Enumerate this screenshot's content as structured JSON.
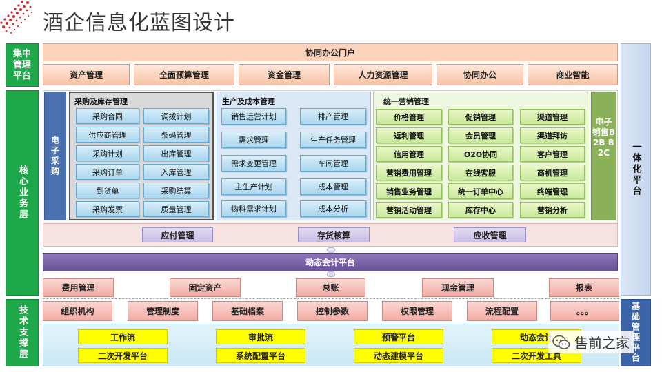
{
  "page_title": "酒企信息化蓝图设计",
  "left_labels": {
    "platform": "集中管理平台",
    "core": "核心业务层",
    "tech": "技术支撑层"
  },
  "right_labels": {
    "integrated": "一体化平台",
    "base": "基础管理平台"
  },
  "portal": "协同办公门户",
  "top_modules": [
    "资产管理",
    "全面预算管理",
    "资金管理",
    "人力资源管理",
    "协同办公",
    "商业智能"
  ],
  "e_purchase": "电子采购",
  "e_sales": "电子销售B2B B2C",
  "purchase_section": {
    "title": "采购及库存管理",
    "left": [
      "采购合同",
      "供应商管理",
      "采购计划",
      "采购订单",
      "到货单",
      "采购发票"
    ],
    "right": [
      "调拨计划",
      "条码管理",
      "出库管理",
      "入库管理",
      "采购结算",
      "质量管理"
    ]
  },
  "production_section": {
    "title": "生产及成本管理",
    "left": [
      "销售运营计划",
      "需求管理",
      "需求变更管理",
      "主生产计划",
      "物料需求计划"
    ],
    "right": [
      "排产管理",
      "生产任务管理",
      "车间管理",
      "成本管理",
      "成本分析"
    ]
  },
  "marketing_section": {
    "title": "统一营销管理",
    "col1": [
      "价格管理",
      "返利管理",
      "信用管理",
      "营销费用管理",
      "销售业务管理",
      "营销活动管理"
    ],
    "col2": [
      "促销管理",
      "会员管理",
      "O2O协同",
      "在线客服",
      "统一订单中心",
      "库存中心"
    ],
    "col3": [
      "渠道管理",
      "渠道拜访",
      "客户管理",
      "商机管理",
      "终端管理",
      "营销分析"
    ]
  },
  "accounting_row": [
    "应付管理",
    "存货核算",
    "应收管理"
  ],
  "dynamic_platform": "动态会计平台",
  "finance_row": [
    "费用管理",
    "固定资产",
    "总账",
    "现金管理",
    "报表"
  ],
  "base_row": [
    "组织机构",
    "管理制度",
    "基础档案",
    "控制参数",
    "权限管理",
    "流程配置",
    "。。。"
  ],
  "tech_row1": [
    "工作流",
    "审批流",
    "预警平台",
    "动态会计"
  ],
  "tech_row2": [
    "二次开发平台",
    "系统配置平台",
    "动态建模平台",
    "二次开发工具"
  ],
  "watermark": "售前之家"
}
